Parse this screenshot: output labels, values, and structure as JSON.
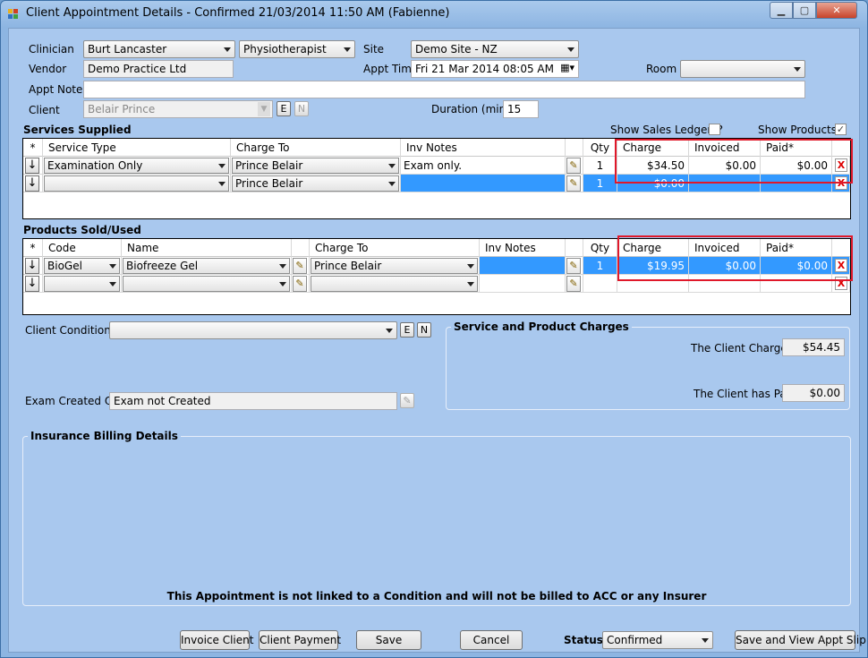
{
  "window": {
    "title": "Client Appointment Details - Confirmed 21/03/2014 11:50 AM (Fabienne)"
  },
  "header": {
    "clinician_label": "Clinician",
    "clinician_value": "Burt Lancaster",
    "role_value": "Physiotherapist",
    "site_label": "Site",
    "site_value": "Demo Site - NZ",
    "vendor_label": "Vendor",
    "vendor_value": "Demo Practice Ltd",
    "appt_time_label": "Appt Time",
    "appt_time_value": "Fri   21 Mar 2014 08:05 AM",
    "room_label": "Room",
    "room_value": "",
    "appt_notes_label": "Appt Notes",
    "appt_notes_value": "",
    "client_label": "Client",
    "client_value": "Belair Prince",
    "duration_label": "Duration (mins)",
    "duration_value": "15",
    "e_label": "E",
    "n_label": "N"
  },
  "services": {
    "title": "Services Supplied",
    "show_sales_label": "Show Sales Ledgers?",
    "show_sales_checked": false,
    "show_products_label": "Show Products?",
    "show_products_checked": true,
    "columns": [
      "*",
      "Service Type",
      "Charge To",
      "Inv Notes",
      "Qty",
      "Charge",
      "Invoiced",
      "Paid*"
    ],
    "rows": [
      {
        "service_type": "Examination Only",
        "charge_to": "Prince Belair",
        "inv_notes": "Exam only.",
        "qty": "1",
        "charge": "$34.50",
        "invoiced": "$0.00",
        "paid": "$0.00"
      },
      {
        "service_type": "",
        "charge_to": "Prince Belair",
        "inv_notes": "",
        "qty": "1",
        "charge": "$0.00",
        "invoiced": "",
        "paid": ""
      }
    ]
  },
  "products": {
    "title": "Products Sold/Used",
    "columns": [
      "*",
      "Code",
      "Name",
      "Charge To",
      "Inv Notes",
      "Qty",
      "Charge",
      "Invoiced",
      "Paid*"
    ],
    "rows": [
      {
        "code": "BioGel",
        "name": "Biofreeze Gel",
        "charge_to": "Prince Belair",
        "inv_notes": "",
        "qty": "1",
        "charge": "$19.95",
        "invoiced": "$0.00",
        "paid": "$0.00"
      },
      {
        "code": "",
        "name": "",
        "charge_to": "",
        "inv_notes": "",
        "qty": "",
        "charge": "",
        "invoiced": "",
        "paid": ""
      }
    ]
  },
  "condition": {
    "client_condition_label": "Client Condition",
    "client_condition_value": "",
    "exam_created_label": "Exam Created On",
    "exam_created_value": "Exam not Created"
  },
  "charges": {
    "title": "Service and Product Charges",
    "client_charge_label": "The Client Charge is",
    "client_charge_value": "$54.45",
    "client_paid_label": "The Client has Paid",
    "client_paid_value": "$0.00"
  },
  "insurance": {
    "title": "Insurance Billing Details",
    "message": "This Appointment is not linked to a Condition and will not be billed to ACC or any Insurer"
  },
  "footer": {
    "invoice_client": "Invoice Client",
    "client_payment": "Client Payment",
    "save": "Save",
    "cancel": "Cancel",
    "status_label": "Status",
    "status_value": "Confirmed",
    "save_view": "Save and View Appt Slip"
  },
  "icons": {
    "arrow_down": "↓",
    "pencil": "✎",
    "delete": "X"
  },
  "colors": {
    "selection": "#3399ff",
    "highlight_box": "#e0182a",
    "client_bg": "#a9c8ee"
  }
}
